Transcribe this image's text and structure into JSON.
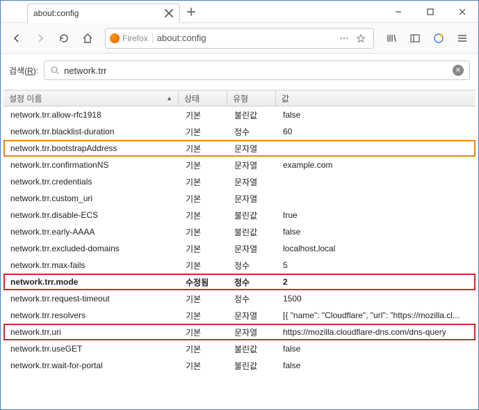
{
  "tab": {
    "title": "about:config"
  },
  "urlbar": {
    "identity": "Firefox",
    "url": "about:config"
  },
  "search": {
    "label_prefix": "검색(",
    "label_accel": "R",
    "label_suffix": "):",
    "value": "network.trr"
  },
  "columns": {
    "name": "설정 이름",
    "status": "상태",
    "type": "유형",
    "value": "값"
  },
  "rows": [
    {
      "name": "network.trr.allow-rfc1918",
      "status": "기본",
      "type": "불린값",
      "value": "false",
      "hl": "",
      "bold": false
    },
    {
      "name": "network.trr.blacklist-duration",
      "status": "기본",
      "type": "정수",
      "value": "60",
      "hl": "",
      "bold": false
    },
    {
      "name": "network.trr.bootstrapAddress",
      "status": "기본",
      "type": "문자열",
      "value": "",
      "hl": "orange",
      "bold": false
    },
    {
      "name": "network.trr.confirmationNS",
      "status": "기본",
      "type": "문자열",
      "value": "example.com",
      "hl": "",
      "bold": false
    },
    {
      "name": "network.trr.credentials",
      "status": "기본",
      "type": "문자열",
      "value": "",
      "hl": "",
      "bold": false
    },
    {
      "name": "network.trr.custom_uri",
      "status": "기본",
      "type": "문자열",
      "value": "",
      "hl": "",
      "bold": false
    },
    {
      "name": "network.trr.disable-ECS",
      "status": "기본",
      "type": "불린값",
      "value": "true",
      "hl": "",
      "bold": false
    },
    {
      "name": "network.trr.early-AAAA",
      "status": "기본",
      "type": "불린값",
      "value": "false",
      "hl": "",
      "bold": false
    },
    {
      "name": "network.trr.excluded-domains",
      "status": "기본",
      "type": "문자열",
      "value": "localhost,local",
      "hl": "",
      "bold": false
    },
    {
      "name": "network.trr.max-fails",
      "status": "기본",
      "type": "정수",
      "value": "5",
      "hl": "",
      "bold": false
    },
    {
      "name": "network.trr.mode",
      "status": "수정됨",
      "type": "정수",
      "value": "2",
      "hl": "red",
      "bold": true
    },
    {
      "name": "network.trr.request-timeout",
      "status": "기본",
      "type": "정수",
      "value": "1500",
      "hl": "",
      "bold": false
    },
    {
      "name": "network.trr.resolvers",
      "status": "기본",
      "type": "문자열",
      "value": "[{ \"name\": \"Cloudflare\", \"url\": \"https://mozilla.cl...",
      "hl": "",
      "bold": false
    },
    {
      "name": "network.trr.uri",
      "status": "기본",
      "type": "문자열",
      "value": "https://mozilla.cloudflare-dns.com/dns-query",
      "hl": "red",
      "bold": false
    },
    {
      "name": "network.trr.useGET",
      "status": "기본",
      "type": "불린값",
      "value": "false",
      "hl": "",
      "bold": false
    },
    {
      "name": "network.trr.wait-for-portal",
      "status": "기본",
      "type": "불린값",
      "value": "false",
      "hl": "",
      "bold": false
    }
  ]
}
